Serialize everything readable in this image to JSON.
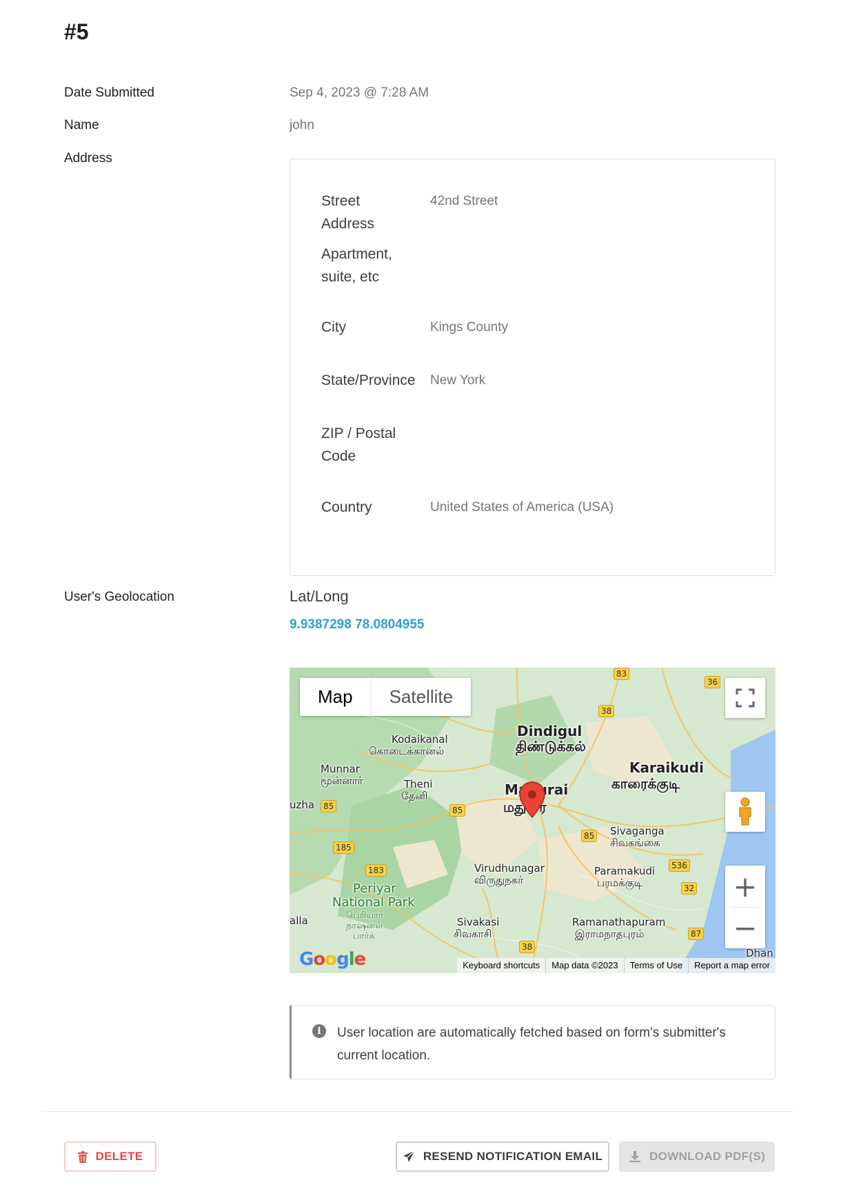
{
  "entry": {
    "title": "#5"
  },
  "fields": {
    "date_submitted": {
      "label": "Date Submitted",
      "value": "Sep 4, 2023 @ 7:28 AM"
    },
    "name": {
      "label": "Name",
      "value": "john"
    },
    "address": {
      "label": "Address"
    },
    "geolocation": {
      "label": "User's Geolocation"
    }
  },
  "address": {
    "street": {
      "label_line1": "Street",
      "label_line2": "Address",
      "value": "42nd Street"
    },
    "apartment": {
      "label_line1": "Apartment,",
      "label_line2": "suite, etc",
      "value": ""
    },
    "city": {
      "label": "City",
      "value": "Kings County"
    },
    "state": {
      "label": "State/Province",
      "value": "New York"
    },
    "zip": {
      "label_line1": "ZIP / Postal",
      "label_line2": "Code",
      "value": ""
    },
    "country": {
      "label": "Country",
      "value": "United States of America (USA)"
    }
  },
  "geo": {
    "heading": "Lat/Long",
    "coords": "9.9387298 78.0804955"
  },
  "map": {
    "type_map": "Map",
    "type_satellite": "Satellite",
    "zoom_in": "+",
    "zoom_out": "−",
    "footer": {
      "shortcuts": "Keyboard shortcuts",
      "data": "Map data ©2023",
      "terms": "Terms of Use",
      "report": "Report a map error"
    },
    "labels": {
      "dindigul_en": "Dindigul",
      "dindigul_ta": "திண்டுக்கல்",
      "kodaikanal_en": "Kodaikanal",
      "kodaikanal_ta": "கொடைக்கானல்",
      "karaikudi_en": "Karaikudi",
      "karaikudi_ta": "காரைக்குடி",
      "munnar_en": "Munnar",
      "munnar_ta": "மூன்னார்",
      "theni_en": "Theni",
      "theni_ta": "தேனி",
      "madurai_en": "Madurai",
      "madurai_ta": "மதுரை",
      "sivaganga_en": "Sivaganga",
      "sivaganga_ta": "சிவகங்கை",
      "virudhunagar_en": "Virudhunagar",
      "virudhunagar_ta": "விருதுநகர்",
      "paramakudi_en": "Paramakudi",
      "paramakudi_ta": "பரமக்குடி",
      "periyar_1": "Periyar",
      "periyar_2": "National Park",
      "periyar_ta1": "பெரியார்",
      "periyar_ta2": "நாஷனல்",
      "periyar_ta3": "பார்க்",
      "sivakasi_en": "Sivakasi",
      "sivakasi_ta": "சிவகாசி",
      "ramanathapuram_en": "Ramanathapuram",
      "ramanathapuram_ta": "இராமநாதபுரம்",
      "dhan": "Dhan",
      "uzha": "uzha",
      "alla": "alla"
    },
    "shields": [
      "83",
      "36",
      "38",
      "85",
      "85",
      "85",
      "185",
      "183",
      "536",
      "32",
      "87",
      "38"
    ]
  },
  "notice": {
    "text": "User location are automatically fetched based on form's submitter's current location."
  },
  "actions": {
    "delete": "DELETE",
    "resend": "RESEND NOTIFICATION EMAIL",
    "download": "DOWNLOAD PDF(S)"
  },
  "colors": {
    "link": "#2ea2cc",
    "delete": "#e84343",
    "map_land": "#d9ead3",
    "map_water": "#9ec8f2",
    "marker": "#ea4335"
  }
}
